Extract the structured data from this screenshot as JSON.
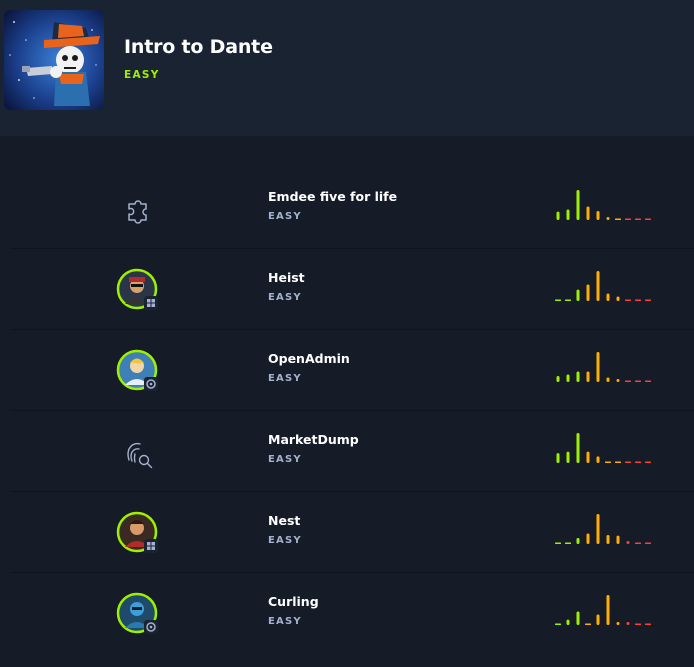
{
  "header": {
    "title": "Intro to Dante",
    "difficulty": "EASY",
    "difficulty_color": "#9fef00"
  },
  "bar_colors": [
    "#9fef00",
    "#9fef00",
    "#9fef00",
    "#ffaf00",
    "#ffaf00",
    "#ffaf00",
    "#ffaf00",
    "#ff3e3e",
    "#ff3e3e",
    "#ff3e3e"
  ],
  "machines": [
    {
      "name": "Emdee five for life",
      "difficulty": "EASY",
      "icon": "puzzle-icon",
      "difficulty_ratings": [
        0.28,
        0.35,
        1.0,
        0.45,
        0.3,
        0.1,
        0,
        0,
        0,
        0
      ]
    },
    {
      "name": "Heist",
      "difficulty": "EASY",
      "icon": "avatar-windows",
      "difficulty_ratings": [
        0,
        0,
        0.38,
        0.55,
        1.0,
        0.25,
        0.15,
        0,
        0,
        0
      ]
    },
    {
      "name": "OpenAdmin",
      "difficulty": "EASY",
      "icon": "avatar-linux",
      "difficulty_ratings": [
        0.2,
        0.25,
        0.35,
        0.35,
        1.0,
        0.15,
        0.1,
        0,
        0,
        0
      ]
    },
    {
      "name": "MarketDump",
      "difficulty": "EASY",
      "icon": "fingerprint-search-icon",
      "difficulty_ratings": [
        0.33,
        0.38,
        1.0,
        0.38,
        0.22,
        0,
        0,
        0,
        0,
        0
      ]
    },
    {
      "name": "Nest",
      "difficulty": "EASY",
      "icon": "avatar-windows",
      "difficulty_ratings": [
        0,
        0,
        0.2,
        0.35,
        1.0,
        0.3,
        0.28,
        0.1,
        0,
        0
      ]
    },
    {
      "name": "Curling",
      "difficulty": "EASY",
      "icon": "avatar-linux",
      "difficulty_ratings": [
        0,
        0.18,
        0.45,
        0,
        0.35,
        1.0,
        0.1,
        0.1,
        0,
        0
      ]
    }
  ]
}
